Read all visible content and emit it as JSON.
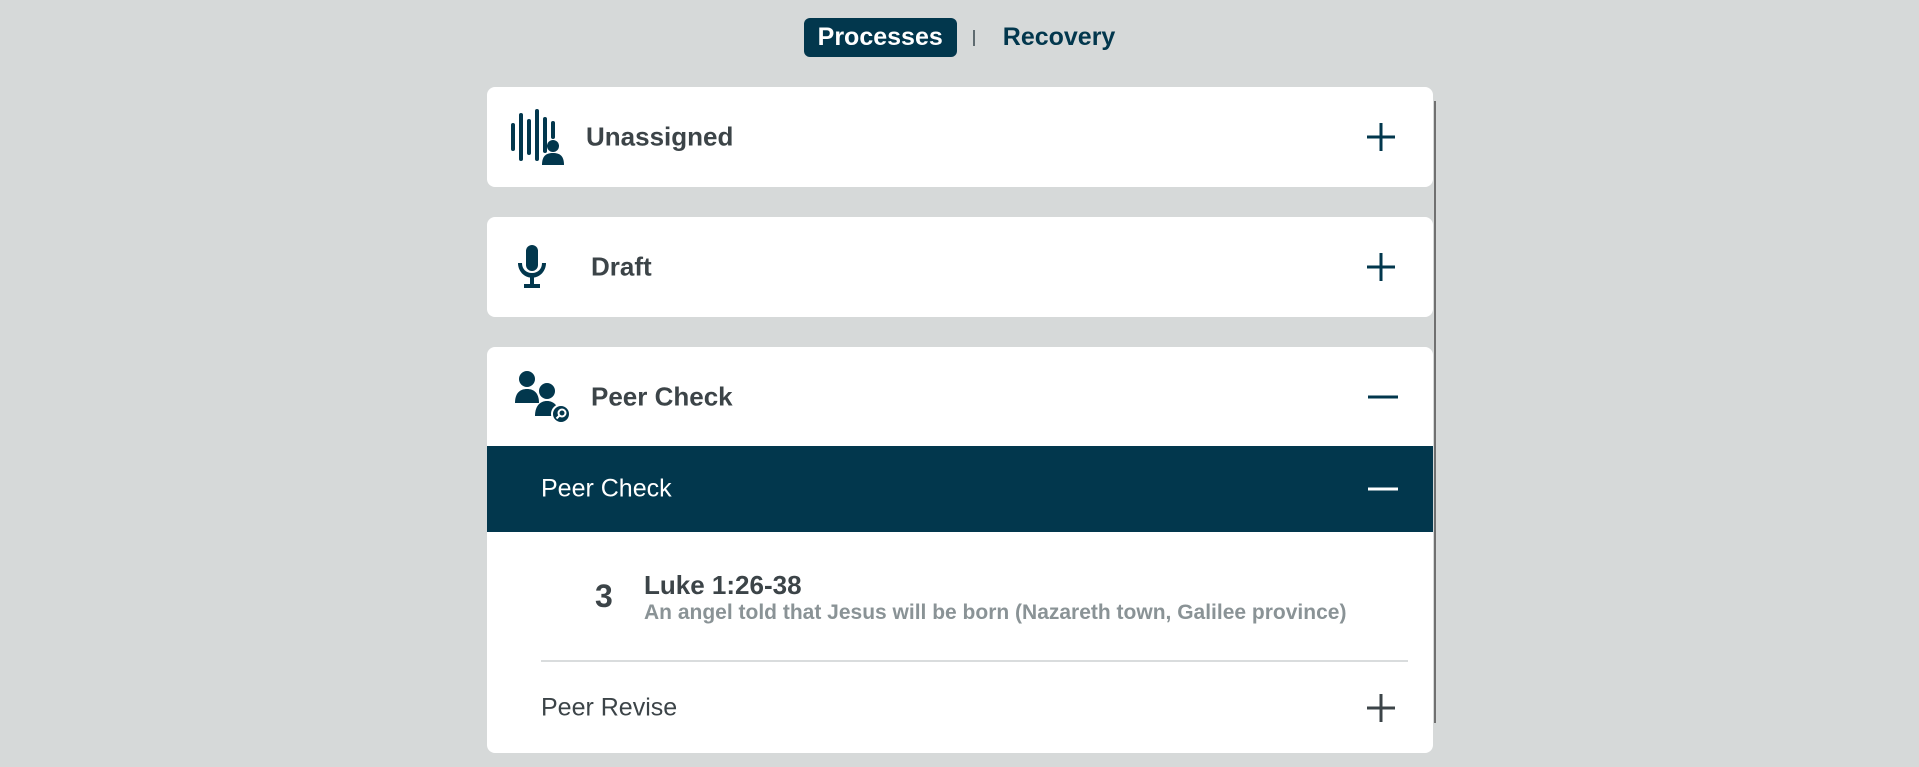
{
  "nav": {
    "active_label": "Processes",
    "other_label": "Recovery"
  },
  "sections": [
    {
      "title": "Unassigned",
      "icon": "waveform-person-icon",
      "toggle": "plus-icon"
    },
    {
      "title": "Draft",
      "icon": "microphone-icon",
      "toggle": "plus-icon"
    },
    {
      "title": "Peer Check",
      "icon": "people-search-icon",
      "toggle": "minus-icon"
    }
  ],
  "peer_check": {
    "sub_title": "Peer Check",
    "task": {
      "number": "3",
      "reference": "Luke 1:26-38",
      "description": "An angel told that Jesus will be born (Nazareth town, Galilee province)"
    },
    "revise_title": "Peer Revise"
  },
  "colors": {
    "accent": "#02374d",
    "background": "#d6d9d9",
    "text": "#3c4448",
    "muted_text": "#8a9396"
  }
}
